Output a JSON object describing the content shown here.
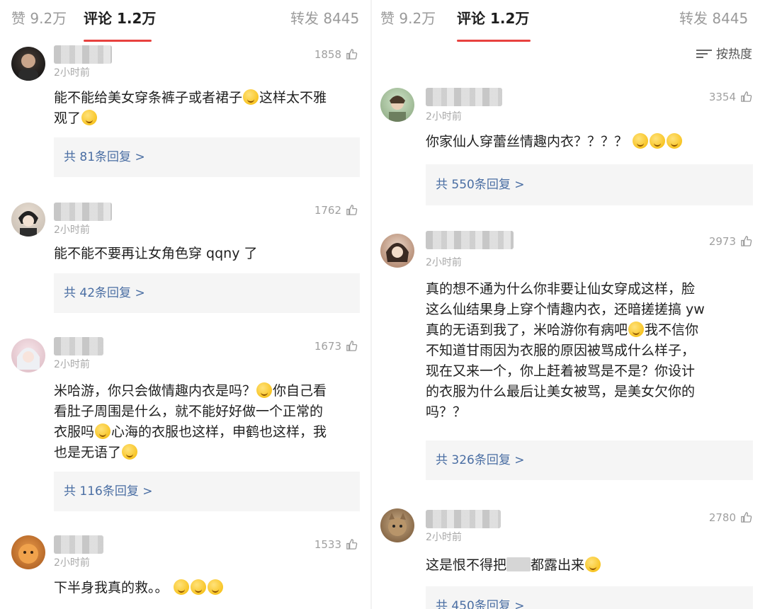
{
  "left": {
    "tabs": {
      "likes": "赞 9.2万",
      "comments": "评论 1.2万",
      "reposts": "转发 8445"
    },
    "comments": [
      {
        "time": "2小时前",
        "likes": "1858",
        "text_lines": [
          "能不能给美女穿条裤子或者裙子",
          "这样太不雅",
          "观了"
        ],
        "replies": "共 81条回复 >"
      },
      {
        "time": "2小时前",
        "likes": "1762",
        "text": "能不能不要再让女角色穿 qqny 了",
        "replies": "共 42条回复 >"
      },
      {
        "time": "2小时前",
        "likes": "1673",
        "text_lines": [
          "米哈游，你只会做情趣内衣是吗？",
          "你自己看",
          "看肚子周围是什么，就不能好好做一个正常的",
          "衣服吗",
          "心海的衣服也这样，申鹤也这样，我",
          "也是无语了"
        ],
        "replies": "共 116条回复 >"
      },
      {
        "time": "2小时前",
        "likes": "1533",
        "text": "下半身我真的救。。"
      }
    ]
  },
  "right": {
    "tabs": {
      "likes": "赞 9.2万",
      "comments": "评论 1.2万",
      "reposts": "转发 8445"
    },
    "sort_label": "按热度",
    "comments": [
      {
        "time": "2小时前",
        "likes": "3354",
        "text": "你家仙人穿蕾丝情趣内衣？？？？",
        "replies": "共 550条回复 >"
      },
      {
        "time": "2小时前",
        "likes": "2973",
        "text_lines": [
          "真的想不通为什么你非要让仙女穿成这样，脸",
          "这么仙结果身上穿个情趣内衣，还暗搓搓搞 yw",
          "真的无语到我了，米哈游你有病吧",
          "我不信你",
          "不知道甘雨因为衣服的原因被骂成什么样子，",
          "现在又来一个，你上赶着被骂是不是？你设计",
          "的衣服为什么最后让美女被骂，是美女欠你的",
          "吗？？"
        ],
        "replies": "共 326条回复 >"
      },
      {
        "time": "2小时前",
        "likes": "2780",
        "text_a": "这是恨不得把",
        "text_b": "都露出来",
        "replies": "共 450条回复 >"
      }
    ]
  },
  "colors": {
    "accent": "#e8423f",
    "reply_link": "#4a6ea3",
    "reply_bg": "#f5f5f5",
    "muted": "#a0a0a0"
  },
  "icons": {
    "like": "thumbs-up-icon",
    "sort": "sort-lines-icon",
    "emoji": "emoji-face-icon"
  }
}
